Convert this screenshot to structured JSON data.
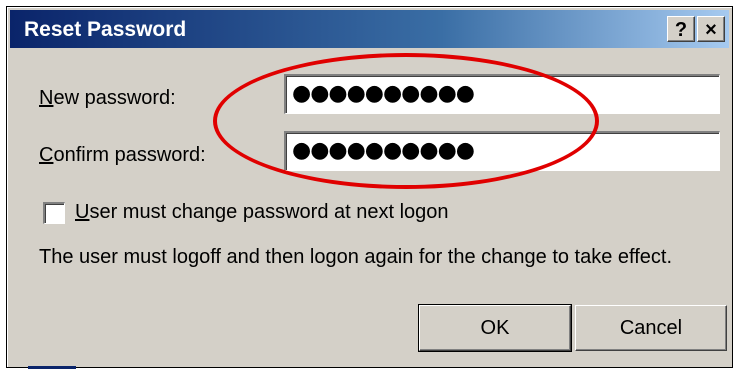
{
  "dialog": {
    "title": "Reset Password",
    "help_glyph": "?",
    "close_glyph": "×",
    "new_password": {
      "label_mnemonic": "N",
      "label_rest": "ew password:",
      "value": "●●●●●●●●●●"
    },
    "confirm_password": {
      "label_mnemonic": "C",
      "label_rest": "onfirm password:",
      "value": "●●●●●●●●●●"
    },
    "must_change": {
      "label_mnemonic": "U",
      "label_rest": "ser must change password at next logon",
      "checked": false
    },
    "info_text": "The user must logoff and then logon again for the change to take effect.",
    "ok_label": "OK",
    "cancel_label": "Cancel"
  },
  "colors": {
    "dialog_face": "#d4d0c8",
    "titlebar": "#0a246a",
    "annotation": "#e00000"
  },
  "icons": [
    "help-icon",
    "close-icon"
  ]
}
